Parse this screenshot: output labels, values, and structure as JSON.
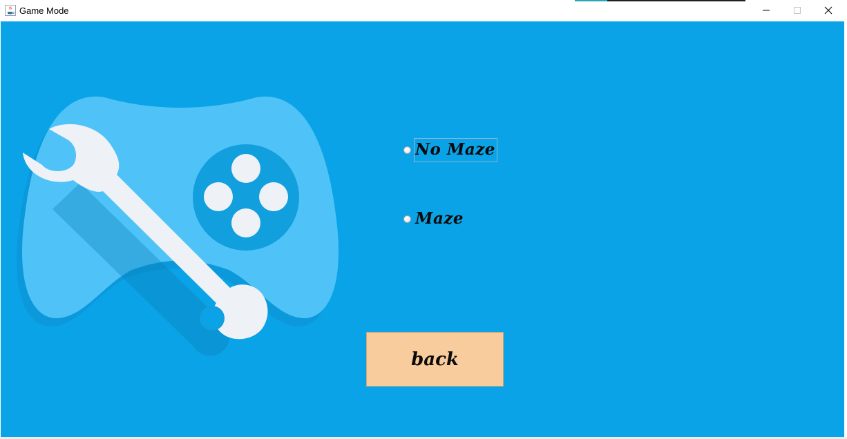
{
  "window": {
    "title": "Game Mode",
    "controls": {
      "minimize": "minimize",
      "maximize": "maximize",
      "close": "close"
    }
  },
  "colors": {
    "background": "#0ba3e7",
    "button": "#f8cc9c",
    "gamepad": "#4fc3f7",
    "wrench": "#eef2f7"
  },
  "mode_options": [
    {
      "label": "No Maze",
      "selected": false,
      "focused": true
    },
    {
      "label": "Maze",
      "selected": false,
      "focused": false
    }
  ],
  "back_button": {
    "label": "back"
  },
  "icons": {
    "app": "java-cup-icon",
    "illustration": "gamepad-wrench-icon"
  }
}
